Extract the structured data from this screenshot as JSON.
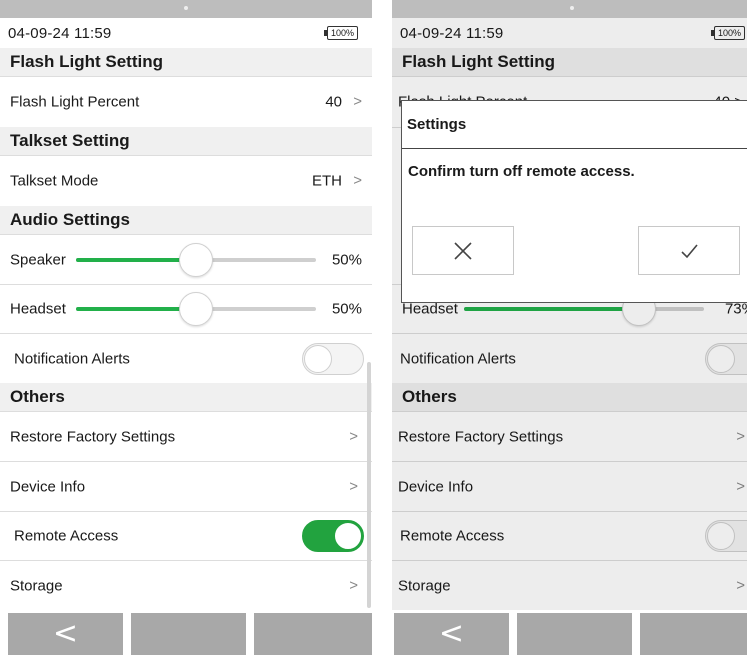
{
  "status": {
    "time": "04-09-24 11:59",
    "battery": "100%"
  },
  "left": {
    "sections": {
      "flash": "Flash Light Setting",
      "talkset": "Talkset Setting",
      "audio": "Audio Settings",
      "others": "Others"
    },
    "rows": {
      "flash_percent": {
        "label": "Flash Light Percent",
        "value": "40",
        "chevron": ">"
      },
      "talkset_mode": {
        "label": "Talkset Mode",
        "value": "ETH",
        "chevron": ">"
      },
      "speaker": {
        "label": "Speaker",
        "value": "50%",
        "level": 0.5
      },
      "headset": {
        "label": "Headset",
        "value": "50%",
        "level": 0.5
      },
      "notification_alerts": {
        "label": "Notification Alerts",
        "on": false
      },
      "restore_factory": {
        "label": "Restore Factory Settings",
        "chevron": ">"
      },
      "device_info": {
        "label": "Device Info",
        "chevron": ">"
      },
      "remote_access": {
        "label": "Remote Access",
        "on": true
      },
      "storage": {
        "label": "Storage",
        "chevron": ">"
      }
    }
  },
  "right": {
    "sections": {
      "flash": "Flash Light Setting",
      "others": "Others"
    },
    "rows": {
      "flash_percent_partial": {
        "label": "Flash Light Percent",
        "value": "40 >"
      },
      "headset_partial": {
        "label": "Headset",
        "value": "73%",
        "level": 0.73
      },
      "notification_alerts": {
        "label": "Notification Alerts",
        "on": false
      },
      "restore_factory": {
        "label": "Restore Factory Settings",
        "chevron": ">"
      },
      "device_info": {
        "label": "Device Info",
        "chevron": ">"
      },
      "remote_access": {
        "label": "Remote Access",
        "on": false
      },
      "storage": {
        "label": "Storage",
        "chevron": ">"
      }
    },
    "dialog": {
      "title": "Settings",
      "message": "Confirm turn off remote access.",
      "cancel_icon": "close-icon",
      "confirm_icon": "check-icon"
    }
  },
  "nav": {
    "back_icon": "back-chevron-icon",
    "back_glyph": "<"
  },
  "colors": {
    "accent_green": "#22b04a",
    "toggle_on": "#22a33f",
    "nav_button": "#a8a8a8",
    "section_bg": "#f0f0f0"
  }
}
